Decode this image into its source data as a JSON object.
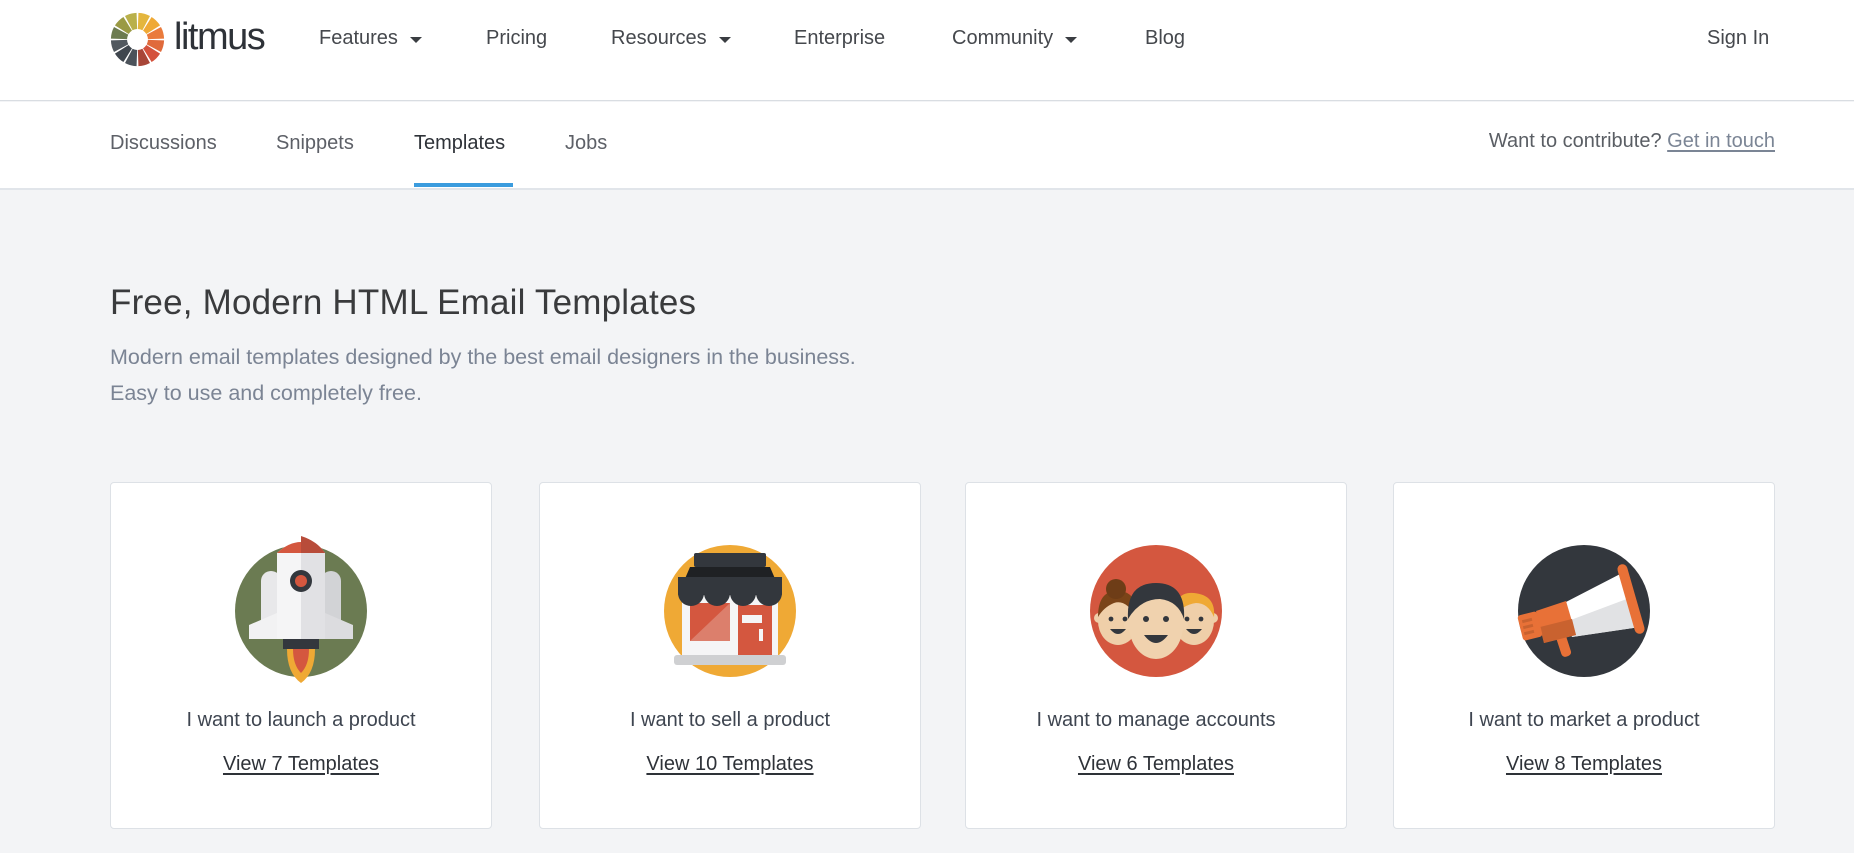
{
  "header": {
    "brand": "litmus",
    "logo_colors": [
      "#e4b63d",
      "#efa935",
      "#ea7b3c",
      "#e06a3b",
      "#d4523d",
      "#a84638",
      "#4b525a",
      "#3f464e",
      "#51585f",
      "#6c7b4f",
      "#9a9a44",
      "#b9b04a"
    ],
    "nav": [
      {
        "label": "Features",
        "dropdown": true
      },
      {
        "label": "Pricing",
        "dropdown": false
      },
      {
        "label": "Resources",
        "dropdown": true
      },
      {
        "label": "Enterprise",
        "dropdown": false
      },
      {
        "label": "Community",
        "dropdown": true
      },
      {
        "label": "Blog",
        "dropdown": false
      }
    ],
    "sign_in": "Sign In"
  },
  "subnav": {
    "items": [
      {
        "label": "Discussions",
        "active": false
      },
      {
        "label": "Snippets",
        "active": false
      },
      {
        "label": "Templates",
        "active": true
      },
      {
        "label": "Jobs",
        "active": false
      }
    ],
    "contribute_text": "Want to contribute?",
    "contribute_link": "Get in touch",
    "accent_color": "#3b9cde"
  },
  "hero": {
    "title": "Free, Modern HTML Email Templates",
    "subtitle": "Modern email templates designed by the best email designers in the business. Easy to use and completely free."
  },
  "cards": [
    {
      "icon": "rocket-icon",
      "title": "I want to launch a product",
      "link": "View 7 Templates",
      "circle_color": "#6b7b52"
    },
    {
      "icon": "storefront-icon",
      "title": "I want to sell a product",
      "link": "View 10 Templates",
      "circle_color": "#efa935"
    },
    {
      "icon": "people-icon",
      "title": "I want to manage accounts",
      "link": "View 6 Templates",
      "circle_color": "#d4573f"
    },
    {
      "icon": "megaphone-icon",
      "title": "I want to market a product",
      "link": "View 8 Templates",
      "circle_color": "#33373d"
    }
  ]
}
